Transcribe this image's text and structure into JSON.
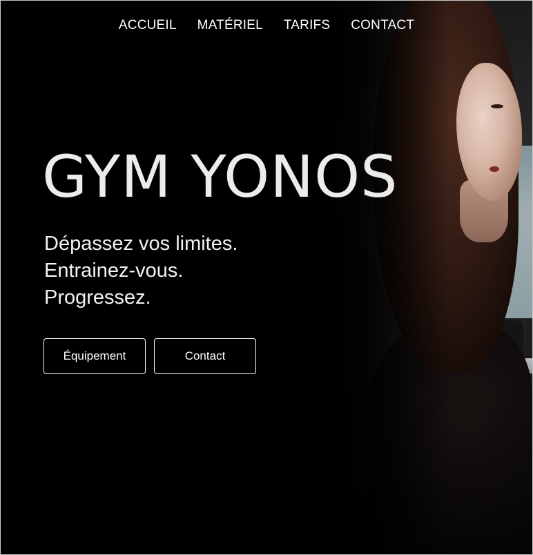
{
  "nav": {
    "items": [
      {
        "label": "ACCUEIL"
      },
      {
        "label": "MATÉRIEL"
      },
      {
        "label": "TARIFS"
      },
      {
        "label": "CONTACT"
      }
    ]
  },
  "hero": {
    "title": "GYM YONOS",
    "tagline": [
      "Dépassez vos limites.",
      "Entrainez-vous.",
      "Progressez."
    ],
    "buttons": {
      "equipment_label": "Équipement",
      "contact_label": "Contact"
    }
  },
  "colors": {
    "background": "#000000",
    "text": "#ffffff",
    "title": "#ececec",
    "border": "#c8c8c8"
  }
}
